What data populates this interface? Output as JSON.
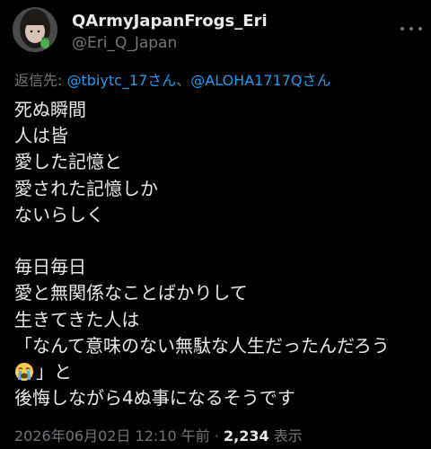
{
  "author": {
    "display_name": "QArmyJapanFrogs_Eri",
    "handle": "@Eri_Q_Japan"
  },
  "reply": {
    "prefix": "返信先: ",
    "mention_1": "@tbiytc_17さん",
    "separator": "、",
    "mention_2": "@ALOHA1717Qさん"
  },
  "body": {
    "lines": [
      "死ぬ瞬間",
      "人は皆",
      "愛した記憶と",
      "愛された記憶しか",
      "ないらしく",
      "",
      "毎日毎日",
      "愛と無関係なことばかりして",
      "生きてきた人は",
      "「なんて意味のない無駄な人生だったんだろう",
      "」と",
      "後悔しながら4ぬ事になるそうです"
    ],
    "emoji_icon": "loudly-crying-face"
  },
  "meta": {
    "timestamp": "2026年06月02日 12:10 午前",
    "separator": " · ",
    "views_count": "2,234",
    "views_label": " 表示"
  },
  "icons": {
    "more": "more-horizontal-icon",
    "avatar": "profile-avatar"
  },
  "colors": {
    "background": "#000000",
    "text": "#e7e9ea",
    "secondary": "#71767b",
    "link": "#1d9bf0"
  }
}
